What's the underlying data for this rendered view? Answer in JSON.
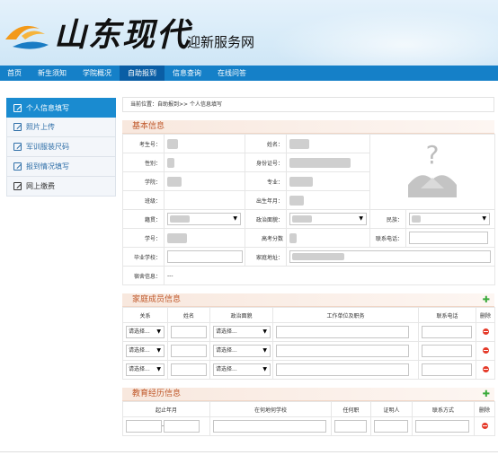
{
  "header": {
    "calligraphy": "山东现代",
    "site_title": "迎新服务网"
  },
  "nav": {
    "items": [
      "首页",
      "新生须知",
      "学院概况",
      "自助报到",
      "信息查询",
      "在线问答"
    ],
    "active_index": 3
  },
  "sidebar": {
    "items": [
      "个人信息填写",
      "照片上传",
      "军训服装尺码",
      "报到情况填写",
      "网上缴费"
    ],
    "active_index": 0
  },
  "breadcrumb": "当前位置：自助报到>> 个人信息填写",
  "basic": {
    "title": "基本信息",
    "labels": {
      "exam_no": "考生号：",
      "name": "姓名：",
      "gender": "性别：",
      "id_no": "身份证号：",
      "college": "学院：",
      "major": "专业：",
      "class": "班级：",
      "birth": "出生年月：",
      "native": "籍贯：",
      "politics": "政治面貌：",
      "ethnic": "民族：",
      "student_no": "学号：",
      "score": "高考分数",
      "phone": "联系电话：",
      "school": "毕业学校：",
      "address": "家庭地址：",
      "dorm": "宿舍信息："
    },
    "dorm_value": "---"
  },
  "family": {
    "title": "家庭成员信息",
    "columns": [
      "关系",
      "姓名",
      "政治面貌",
      "工作单位及职务",
      "联系电话",
      "删除"
    ],
    "rows": [
      {
        "relation": "请选择...",
        "politics": "请选择..."
      },
      {
        "relation": "请选择...",
        "politics": "请选择..."
      },
      {
        "relation": "请选择...",
        "politics": "请选择..."
      }
    ]
  },
  "education": {
    "title": "教育经历信息",
    "columns": [
      "起止年月",
      "在何地何学校",
      "任何职",
      "证明人",
      "联系方式",
      "删除"
    ],
    "date_sep": "-"
  },
  "colors": {
    "nav": "#1580c8",
    "accent": "#1a8bd0",
    "section": "#c0582a"
  }
}
